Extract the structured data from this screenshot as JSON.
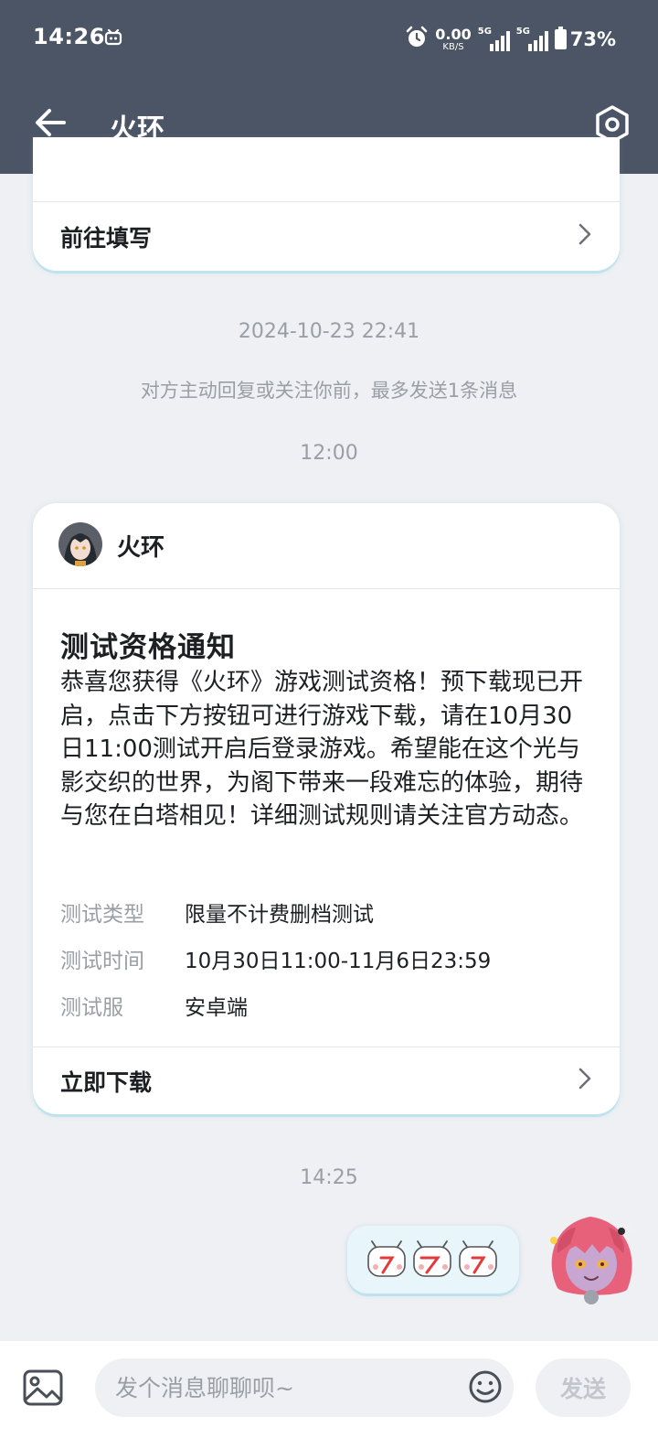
{
  "status_bar": {
    "time": "14:26",
    "net_speed": "0.00",
    "net_unit": "KB/S",
    "sim1_tag": "5G",
    "sim2_tag": "5G",
    "battery": "73%"
  },
  "nav": {
    "title": "火环"
  },
  "top_card": {
    "link_label": "前往填写"
  },
  "timeline": {
    "ts1": "2024-10-23 22:41",
    "notice": "对方主动回复或关注你前，最多发送1条消息",
    "ts2": "12:00",
    "ts3": "14:25"
  },
  "message_card": {
    "sender": "火环",
    "title": "测试资格通知",
    "body": "恭喜您获得《火环》游戏测试资格！预下载现已开启，点击下方按钮可进行游戏下载，请在10月30日11:00测试开启后登录游戏。希望能在这个光与影交织的世界，为阁下带来一段难忘的体验，期待与您在白塔相见！详细测试规则请关注官方动态。",
    "fields": [
      {
        "key": "测试类型",
        "value": "限量不计费删档测试"
      },
      {
        "key": "测试时间",
        "value": "10月30日11:00-11月6日23:59"
      },
      {
        "key": "测试服",
        "value": "安卓端"
      }
    ],
    "action_label": "立即下载"
  },
  "input": {
    "placeholder": "发个消息聊聊呗~",
    "send_label": "发送"
  },
  "icons": [
    "alarm-icon",
    "back-arrow-icon",
    "settings-hexagon-icon",
    "chevron-right-icon",
    "image-icon",
    "emoji-icon"
  ],
  "colors": {
    "header": "#4c5566",
    "background": "#eef0f3",
    "bubble": "#e8f6fb",
    "accent_shadow": "#bfe2ef"
  }
}
